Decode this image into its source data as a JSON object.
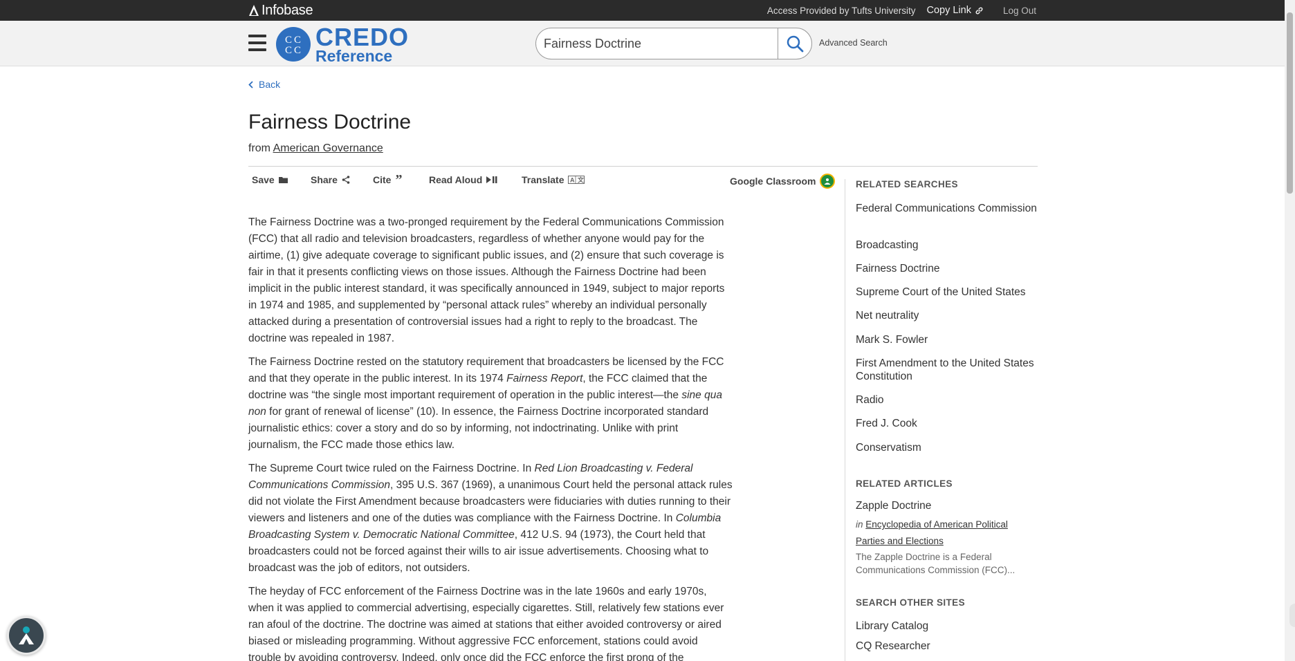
{
  "topbar": {
    "brand": "Infobase",
    "access": "Access Provided by Tufts University",
    "copy_link": "Copy Link",
    "logout": "Log Out"
  },
  "header": {
    "logo_line1": "CREDO",
    "logo_line2": "Reference",
    "search_value": "Fairness Doctrine",
    "advanced_search": "Advanced Search"
  },
  "nav": {
    "back": "Back"
  },
  "article": {
    "title": "Fairness Doctrine",
    "from_prefix": "from",
    "source": "American Governance"
  },
  "toolbar": {
    "save": "Save",
    "share": "Share",
    "cite": "Cite",
    "read_aloud": "Read Aloud",
    "translate": "Translate",
    "google_classroom": "Google Classroom"
  },
  "body": {
    "p1": "The Fairness Doctrine was a two-pronged requirement by the Federal Communications Commission (FCC) that all radio and television broadcasters, regardless of whether anyone would pay for the airtime, (1) give adequate coverage to significant public issues, and (2) ensure that such coverage is fair in that it presents conflicting views on those issues. Although the Fairness Doctrine had been implicit in the public interest standard, it was specifically announced in 1949, subject to major reports in 1974 and 1985, and supplemented by “personal attack rules” whereby an individual personally attacked during a presentation of controversial issues had a right to reply to the broadcast. The doctrine was repealed in 1987.",
    "p2_a": "The Fairness Doctrine rested on the statutory requirement that broadcasters be licensed by the FCC and that they operate in the public interest. In its 1974 ",
    "p2_i1": "Fairness Report",
    "p2_b": ", the FCC claimed that the doctrine was “the single most important requirement of operation in the public interest—the ",
    "p2_i2": "sine qua non",
    "p2_c": " for grant of renewal of license” (10). In essence, the Fairness Doctrine incorporated standard journalistic ethics: cover a story and do so by informing, not indoctrinating. Unlike with print journalism, the FCC made those ethics law.",
    "p3_a": "The Supreme Court twice ruled on the Fairness Doctrine. In ",
    "p3_i1": "Red Lion Broadcasting v. Federal Communications Commission",
    "p3_b": ", 395 U.S. 367 (1969), a unanimous Court held the personal attack rules did not violate the First Amendment because broadcasters were fiduciaries with duties running to their viewers and listeners and one of the duties was compliance with the Fairness Doctrine. In ",
    "p3_i2": "Columbia Broadcasting System v. Democratic National Committee",
    "p3_c": ", 412 U.S. 94 (1973), the Court held that broadcasters could not be forced against their wills to air issue advertisements. Choosing what to broadcast was the job of editors, not outsiders.",
    "p4": "The heyday of FCC enforcement of the Fairness Doctrine was in the late 1960s and early 1970s, when it was applied to commercial advertising, especially cigarettes. Still, relatively few stations ever ran afoul of the doctrine. The doctrine was aimed at stations that either avoided controversy or aired biased or misleading programming. Without aggressive FCC enforcement, stations could avoid trouble by avoiding controversy. Indeed, only once did the FCC enforce the first prong of the"
  },
  "sidebar": {
    "related_searches_heading": "RELATED SEARCHES",
    "related_searches": [
      "Federal Communications Commission",
      "Broadcasting",
      "Fairness Doctrine",
      "Supreme Court of the United States",
      "Net neutrality",
      "Mark S. Fowler",
      "First Amendment to the United States Constitution",
      "Radio",
      "Fred J. Cook",
      "Conservatism"
    ],
    "related_articles_heading": "RELATED ARTICLES",
    "article_title": "Zapple Doctrine",
    "article_in": "in",
    "article_source": "Encyclopedia of American Political Parties and Elections",
    "article_snippet": "The Zapple Doctrine is a Federal Communications Commission (FCC)...",
    "other_sites_heading": "SEARCH OTHER SITES",
    "other_sites": [
      "Library Catalog",
      "CQ Researcher"
    ]
  }
}
